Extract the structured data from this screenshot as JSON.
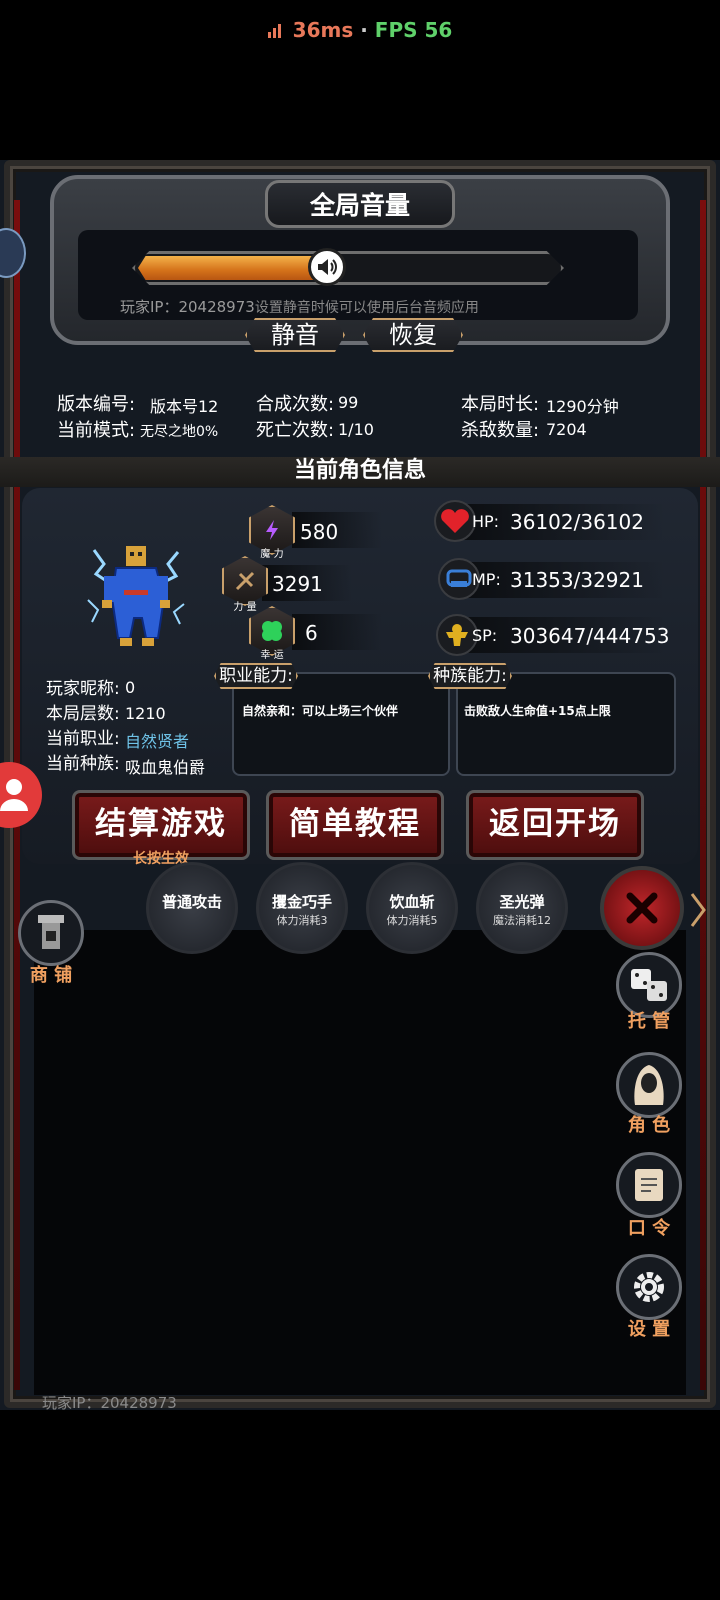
{
  "status": {
    "ping": "36ms",
    "fps": "FPS 56",
    "separator": "·"
  },
  "volume": {
    "title": "全局音量",
    "level": 0.45,
    "hint": "设置静音时候可以使用后台音频应用",
    "player_ip": "玩家IP：20428973",
    "mute_label": "静音",
    "restore_label": "恢复"
  },
  "stats": {
    "version_label": "版本编号:",
    "version_value": "版本号12",
    "mode_label": "当前模式:",
    "mode_value": "无尽之地0%",
    "craft_label": "合成次数:",
    "craft_value": "99",
    "death_label": "死亡次数:",
    "death_value": "1/10",
    "time_label": "本局时长:",
    "time_value": "1290分钟",
    "kills_label": "杀敌数量:",
    "kills_value": "7204"
  },
  "character": {
    "section_title": "当前角色信息",
    "magic": {
      "label": "魔 力",
      "value": "580"
    },
    "power": {
      "label": "力 量",
      "value": "3291"
    },
    "luck": {
      "label": "幸 运",
      "value": "6"
    },
    "hp": {
      "label": "HP:",
      "value": "36102/36102"
    },
    "mp": {
      "label": "MP:",
      "value": "31353/32921"
    },
    "sp": {
      "label": "SP:",
      "value": "303647/444753"
    },
    "nickname_label": "玩家昵称:",
    "nickname_value": "0",
    "floor_label": "本局层数:",
    "floor_value": "1210",
    "job_label": "当前职业:",
    "job_value": "自然贤者",
    "race_label": "当前种族:",
    "race_value": "吸血鬼伯爵",
    "job_ability_tag": "职业能力:",
    "job_ability_text": "自然亲和：可以上场三个伙伴",
    "race_ability_tag": "种族能力:",
    "race_ability_text": "击败敌人生命值+15点上限"
  },
  "actions": {
    "settle": "结算游戏",
    "settle_sub": "长按生效",
    "tutorial": "简单教程",
    "back": "返回开场"
  },
  "skills": [
    {
      "name": "普通攻击",
      "cost": ""
    },
    {
      "name": "攫金巧手",
      "cost": "体力消耗3"
    },
    {
      "name": "饮血斩",
      "cost": "体力消耗5"
    },
    {
      "name": "圣光弹",
      "cost": "魔法消耗12"
    }
  ],
  "side_menu": {
    "shop": "商 铺",
    "auto": "托 管",
    "role": "角 色",
    "code": "口 令",
    "settings": "设 置"
  },
  "footer": {
    "player_ip": "玩家IP：20428973"
  },
  "colors": {
    "accent": "#c9a06b",
    "job_value": "#6fc3e8",
    "side_label": "#f0a060",
    "ping": "#e8785a",
    "fps": "#5fd06a"
  }
}
